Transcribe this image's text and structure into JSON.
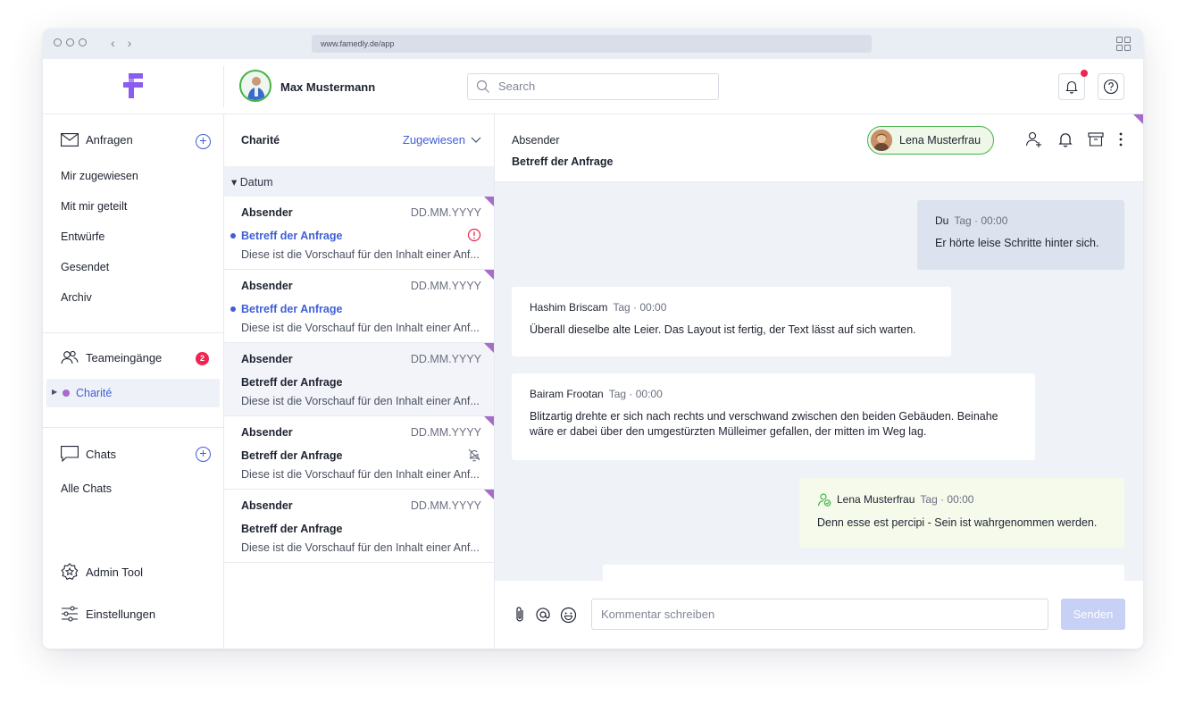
{
  "browser": {
    "url": "www.famedly.de/app"
  },
  "header": {
    "user_name": "Max Mustermann",
    "search_placeholder": "Search"
  },
  "sidebar": {
    "requests": {
      "title": "Anfragen",
      "items": [
        "Mir zugewiesen",
        "Mit mir geteilt",
        "Entwürfe",
        "Gesendet",
        "Archiv"
      ]
    },
    "team": {
      "title": "Teameingänge",
      "badge": "2",
      "inbox": "Charité"
    },
    "chats": {
      "title": "Chats",
      "items": [
        "Alle Chats"
      ]
    },
    "admin_tool": "Admin Tool",
    "settings": "Einstellungen"
  },
  "list": {
    "title": "Charité",
    "filter": "Zugewiesen",
    "group": "Datum",
    "items": [
      {
        "sender": "Absender",
        "date": "DD.MM.YYYY",
        "subject": "Betreff der Anfrage",
        "preview": "Diese ist die Vorschauf für den Inhalt einer Anf...",
        "unread": true,
        "flag": "alert-icon"
      },
      {
        "sender": "Absender",
        "date": "DD.MM.YYYY",
        "subject": "Betreff der Anfrage",
        "preview": "Diese ist die Vorschauf für den Inhalt einer Anf...",
        "unread": true
      },
      {
        "sender": "Absender",
        "date": "DD.MM.YYYY",
        "subject": "Betreff der Anfrage",
        "preview": "Diese ist die Vorschauf für den Inhalt einer Anf...",
        "selected": true
      },
      {
        "sender": "Absender",
        "date": "DD.MM.YYYY",
        "subject": "Betreff der Anfrage",
        "preview": "Diese ist die Vorschauf für den Inhalt einer Anf...",
        "flag": "bell-off-icon"
      },
      {
        "sender": "Absender",
        "date": "DD.MM.YYYY",
        "subject": "Betreff der Anfrage",
        "preview": "Diese ist die Vorschauf für den Inhalt einer Anf..."
      }
    ]
  },
  "conversation": {
    "sender": "Absender",
    "subject": "Betreff der Anfrage",
    "assignee": "Lena Musterfrau",
    "messages": [
      {
        "author": "Du",
        "time": "Tag · 00:00",
        "text": "Er hörte leise Schritte hinter sich."
      },
      {
        "author": "Hashim Briscam",
        "time": "Tag · 00:00",
        "text": "Überall dieselbe alte Leier. Das Layout ist fertig, der Text lässt auf sich warten."
      },
      {
        "author": "Bairam Frootan",
        "time": "Tag · 00:00",
        "text": "Blitzartig drehte er sich nach rechts und verschwand zwischen den beiden Gebäuden. Beinahe wäre er dabei über den umgestürzten Mülleimer gefallen, der mitten im Weg lag."
      },
      {
        "author": "Lena Musterfrau",
        "time": "Tag · 00:00",
        "text": "Denn esse est percipi - Sein ist wahrgenommen werden."
      }
    ],
    "composer_placeholder": "Kommentar schreiben",
    "send_label": "Senden"
  },
  "colors": {
    "accent": "#3f5fd8",
    "brand_purple": "#a56cc8",
    "online_green": "#44b24a",
    "badge_red": "#f0244d"
  }
}
